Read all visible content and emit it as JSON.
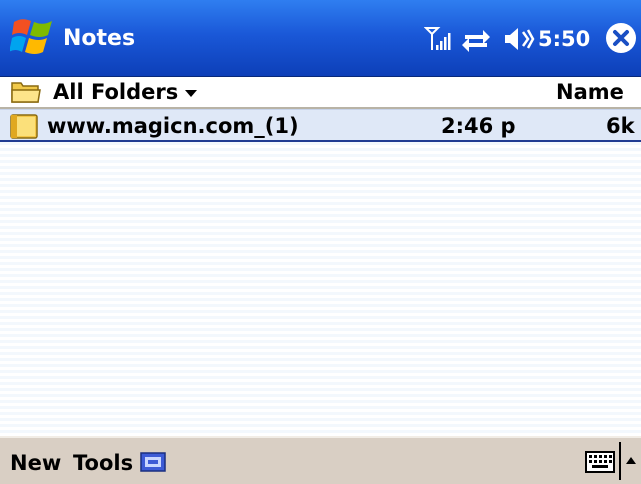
{
  "titlebar": {
    "app_title": "Notes",
    "clock": "5:50",
    "icons": {
      "start": "windows-flag-icon",
      "signal": "signal-icon",
      "sync": "connectivity-icon",
      "volume": "speaker-icon",
      "close": "close-icon"
    }
  },
  "folderbar": {
    "folder_label": "All Folders",
    "sort_label": "Name"
  },
  "notes": [
    {
      "name": "www.magicn.com_(1)",
      "time": "2:46 p",
      "size": "6k"
    }
  ],
  "menubar": {
    "new_label": "New",
    "tools_label": "Tools"
  },
  "colors": {
    "titlebar": "#1a58d8",
    "selection": "#dfe8f7",
    "menubar": "#d9cfc4"
  }
}
